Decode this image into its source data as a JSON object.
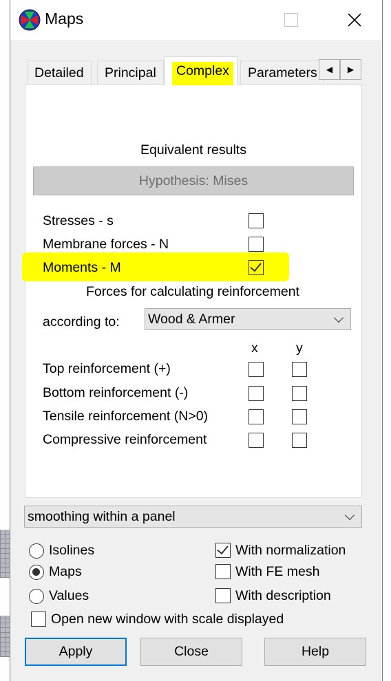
{
  "window": {
    "title": "Maps",
    "app_icon": "maps-app-icon"
  },
  "tabs": [
    {
      "label": "Detailed"
    },
    {
      "label": "Principal"
    },
    {
      "label": "Complex"
    },
    {
      "label": "Parameters"
    }
  ],
  "complex": {
    "heading": "Equivalent results",
    "hypothesis_button": "Hypothesis: Mises",
    "result_types": [
      {
        "label": "Stresses - s",
        "checked": false
      },
      {
        "label": "Membrane forces - N",
        "checked": false
      },
      {
        "label": "Moments - M",
        "checked": true
      }
    ],
    "reinforcement_heading": "Forces for calculating reinforcement",
    "according_label": "according to:",
    "according_value": "Wood & Armer",
    "col_x": "x",
    "col_y": "y",
    "reinforcement": [
      {
        "label": "Top reinforcement (+)"
      },
      {
        "label": "Bottom reinforcement (-)"
      },
      {
        "label": "Tensile reinforcement (N>0)"
      },
      {
        "label": "Compressive reinforcement"
      }
    ]
  },
  "smoothing": "smoothing within a panel",
  "display_modes": [
    {
      "label": "Isolines",
      "selected": false
    },
    {
      "label": "Maps",
      "selected": true
    },
    {
      "label": "Values",
      "selected": false
    }
  ],
  "display_options": [
    {
      "label": "With normalization",
      "checked": true
    },
    {
      "label": "With FE mesh",
      "checked": false
    },
    {
      "label": "With description",
      "checked": false
    }
  ],
  "open_window": {
    "label": "Open new window with scale displayed",
    "checked": false
  },
  "buttons": {
    "apply": "Apply",
    "close": "Close",
    "help": "Help"
  },
  "highlight_color": "#ffff00",
  "accent_color": "#0078d7"
}
